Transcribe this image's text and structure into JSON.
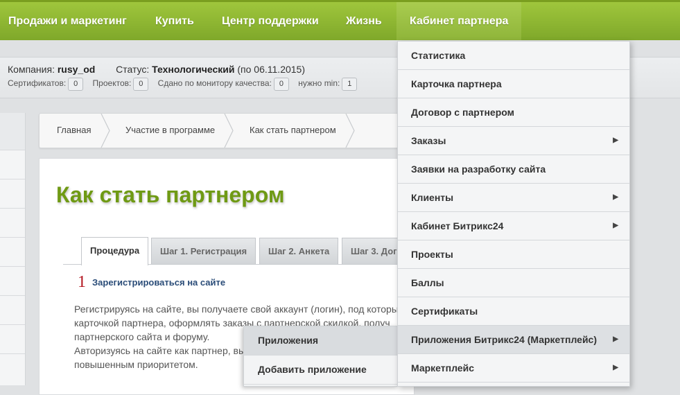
{
  "topnav": {
    "items": [
      "Продажи и маркетинг",
      "Купить",
      "Центр поддержки",
      "Жизнь",
      "Кабинет партнера"
    ]
  },
  "info": {
    "company_label": "Компания:",
    "company_value": "rusy_od",
    "status_label": "Статус:",
    "status_value": "Технологический",
    "status_date": "(по 06.11.2015)",
    "certs_label": "Сертификатов:",
    "certs_value": "0",
    "projects_label": "Проектов:",
    "projects_value": "0",
    "quality_label": "Сдано по монитору качества:",
    "quality_value": "0",
    "min_label": "нужно min:",
    "min_value": "1"
  },
  "breadcrumb": [
    "Главная",
    "Участие в программе",
    "Как стать партнером"
  ],
  "main": {
    "title": "Как стать партнером",
    "tabs": [
      "Процедура",
      "Шаг 1. Регистрация",
      "Шаг 2. Анкета",
      "Шаг 3. Дог"
    ],
    "step_number": "1",
    "step_link": "Зарегистрироваться на сайте",
    "desc_lines": [
      "Регистрируясь на сайте, вы получаете свой аккаунт (логин), под которым",
      "карточкой партнера, оформлять заказы с партнерской скидкой, получ",
      "партнерского сайта и форуму.",
      "Авторизуясь на сайте как партнер, вы",
      "повышенным приоритетом."
    ]
  },
  "dropdown": {
    "items": [
      {
        "label": "Статистика",
        "submenu": false
      },
      {
        "label": "Карточка партнера",
        "submenu": false
      },
      {
        "label": "Договор с партнером",
        "submenu": false
      },
      {
        "label": "Заказы",
        "submenu": true
      },
      {
        "label": "Заявки на разработку сайта",
        "submenu": false
      },
      {
        "label": "Клиенты",
        "submenu": true
      },
      {
        "label": "Кабинет Битрикс24",
        "submenu": true
      },
      {
        "label": "Проекты",
        "submenu": false
      },
      {
        "label": "Баллы",
        "submenu": false
      },
      {
        "label": "Сертификаты",
        "submenu": false
      },
      {
        "label": "Приложения Битрикс24 (Маркетплейс)",
        "submenu": true
      },
      {
        "label": "Маркетплейс",
        "submenu": true
      }
    ],
    "arrow_glyph": "▶"
  },
  "submenu": {
    "items": [
      "Приложения",
      "Добавить приложение"
    ]
  },
  "colors": {
    "nav_green": "#8fb632",
    "title_green": "#6f9a14",
    "step_red": "#b2141e",
    "link_blue": "#2a4c78"
  }
}
